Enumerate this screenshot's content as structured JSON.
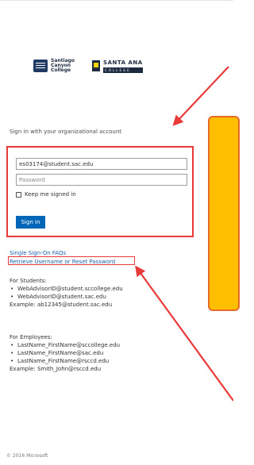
{
  "logos": {
    "santiago_lines": [
      "Santiago",
      "Canyon",
      "College"
    ],
    "santa_ana_top": "SANTA ANA",
    "santa_ana_bottom": "COLLEGE"
  },
  "signin": {
    "heading": "Sign in with your organizational account",
    "username_value": "es03174@student.sac.edu",
    "password_placeholder": "Password",
    "keep_signed_in": "Keep me signed in",
    "button": "Sign in"
  },
  "links": {
    "faq": "Single Sign-On FAQs",
    "retrieve": "Retrieve Username or Reset Password"
  },
  "students": {
    "heading": "For Students:",
    "items": [
      "WebAdvisorID@student.sccollege.edu",
      "WebAdvisorID@student.sac.edu"
    ],
    "example": "Example: ab12345@student.sac.edu"
  },
  "employees": {
    "heading": "For Employees:",
    "items": [
      "LastName_FirstName@sccollege.edu",
      "LastName_FirstName@sac.edu",
      "LastName_FirstName@rsccd.edu"
    ],
    "example": "Example: Smith_John@rsccd.edu"
  },
  "footer": {
    "copyright": "© 2016 Microsoft"
  },
  "colors": {
    "annotation_red": "#e93a3a",
    "button_blue": "#0067b8",
    "link_blue": "#1f5faa",
    "callout_yellow": "#ffbf00"
  }
}
